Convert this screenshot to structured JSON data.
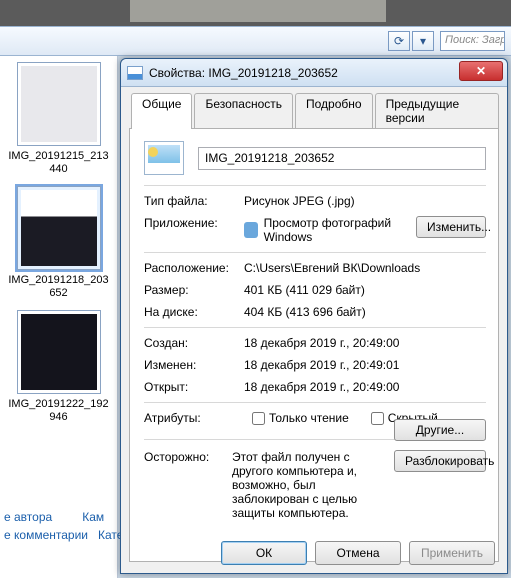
{
  "nav": {
    "search_placeholder": "Поиск: Загру"
  },
  "thumbs": [
    {
      "caption": "IMG_20191215_213440",
      "selected": false,
      "bg": "#e6e6ea"
    },
    {
      "caption": "IMG_20191218_203652",
      "selected": true,
      "bg": "#ffffff"
    },
    {
      "caption": "IMG_20191222_192946",
      "selected": false,
      "bg": "#171720"
    }
  ],
  "bottom_links": {
    "author": "е автора",
    "comments": "е комментарии",
    "cam": "Кам",
    "cat": "Кате"
  },
  "dialog": {
    "title": "Свойства: IMG_20191218_203652",
    "tabs": {
      "general": "Общие",
      "security": "Безопасность",
      "details": "Подробно",
      "previous": "Предыдущие версии"
    },
    "filename": "IMG_20191218_203652",
    "rows": {
      "type_lbl": "Тип файла:",
      "type_val": "Рисунок JPEG (.jpg)",
      "app_lbl": "Приложение:",
      "app_val": "Просмотр фотографий Windows",
      "change_btn": "Изменить...",
      "location_lbl": "Расположение:",
      "location_val": "C:\\Users\\Евгений ВК\\Downloads",
      "size_lbl": "Размер:",
      "size_val": "401 КБ (411 029 байт)",
      "ondisk_lbl": "На диске:",
      "ondisk_val": "404 КБ (413 696 байт)",
      "created_lbl": "Создан:",
      "created_val": "18 декабря 2019 г., 20:49:00",
      "modified_lbl": "Изменен:",
      "modified_val": "18 декабря 2019 г., 20:49:01",
      "accessed_lbl": "Открыт:",
      "accessed_val": "18 декабря 2019 г., 20:49:00",
      "attrib_lbl": "Атрибуты:",
      "readonly": "Только чтение",
      "hidden": "Скрытый",
      "other_btn": "Другие...",
      "warn_lbl": "Осторожно:",
      "warn_val": "Этот файл получен с другого компьютера и, возможно, был заблокирован с целью защиты компьютера.",
      "unblock_btn": "Разблокировать"
    },
    "buttons": {
      "ok": "ОК",
      "cancel": "Отмена",
      "apply": "Применить"
    }
  }
}
